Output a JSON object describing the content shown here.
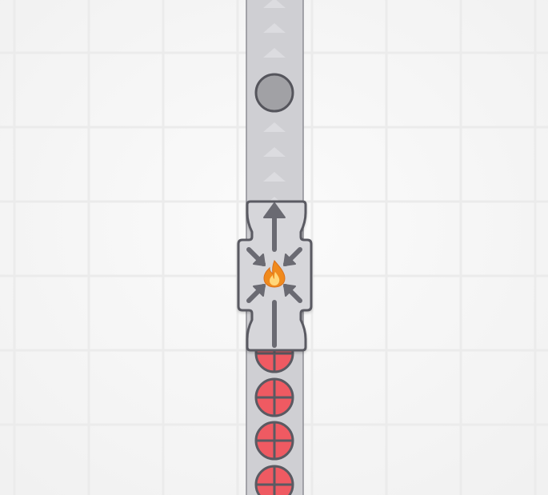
{
  "scene": {
    "type": "factory-puzzle-board",
    "background_color": "#f7f7f7",
    "grid_color": "#ebebeb",
    "belt_color": "#cfcfd3",
    "belt_border_color": "#8d8d94",
    "belt_arrow_color": "#dcdce0",
    "machine_body_color": "#d6d6da",
    "machine_border_color": "#5a5a62",
    "machine_arrow_color": "#6a6a72",
    "flame_outer_color": "#f08a1e",
    "flame_inner_color": "#ffd77a",
    "input_item_color": "#ef5a62",
    "output_item_color": "#a1a1a5"
  },
  "conveyor": {
    "direction": "up",
    "name": "conveyor-belt"
  },
  "machine": {
    "name": "furnace",
    "icon": "fire-icon",
    "input_arrows_icon": "compress-arrows-icon",
    "output_arrow_icon": "arrow-up-icon"
  },
  "items": {
    "input": {
      "kind": "red-crosshair-circle",
      "visible_count": 4
    },
    "output": {
      "kind": "gray-circle",
      "visible_count": 1
    }
  }
}
